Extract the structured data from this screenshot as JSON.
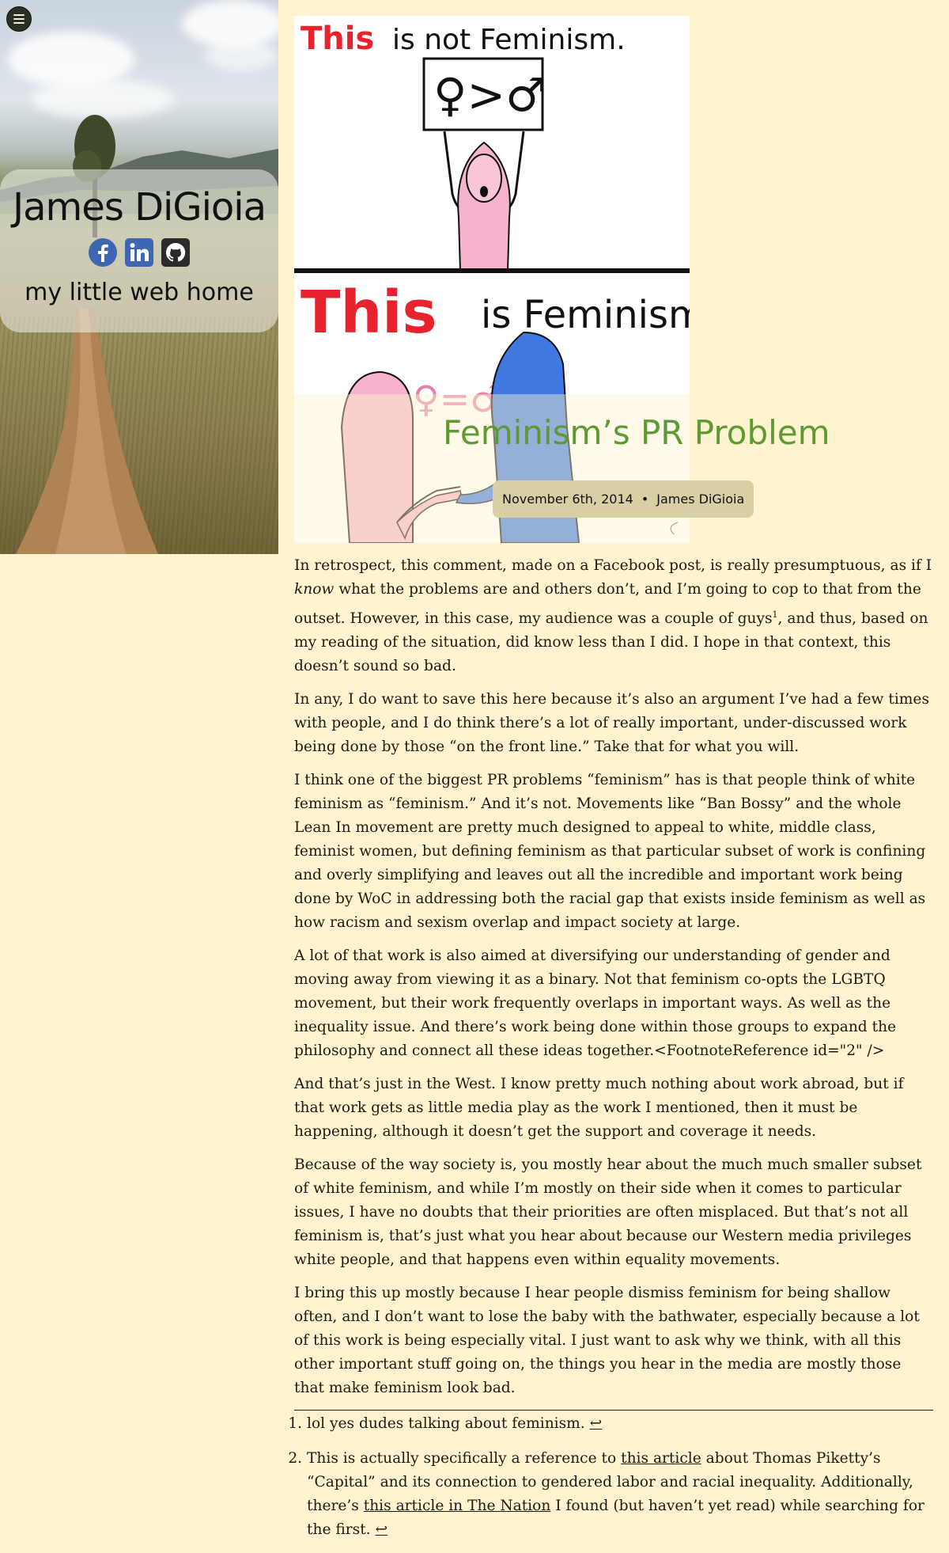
{
  "sidebar": {
    "menu_icon": "hamburger-menu-icon",
    "title": "James DiGioia",
    "tagline": "my little web home",
    "socials": [
      {
        "name": "facebook",
        "icon": "facebook-icon",
        "color": "#3b5998"
      },
      {
        "name": "linkedin",
        "icon": "linkedin-icon",
        "color": "#0e76a8"
      },
      {
        "name": "github",
        "icon": "github-icon",
        "color": "#24292e"
      }
    ]
  },
  "hero": {
    "line1_red": "This",
    "line1_rest": "is not Feminism.",
    "sign_text": "♀>♂",
    "line2_red": "This",
    "line2_rest": "is Feminism.",
    "equation": "♀=♂"
  },
  "post": {
    "title": "Feminism’s PR Problem",
    "date": "November 6th, 2014",
    "separator": "•",
    "author": "James DiGioia",
    "title_color": "#5e9a33"
  },
  "paragraphs": {
    "p1_a": "In retrospect, this comment, made on a Facebook post, is really presumptuous, as if I ",
    "p1_em": "know",
    "p1_b": " what the problems are and others don’t, and I’m going to cop to that from the outset. However, in this case, my audience was a couple of guys",
    "p1_fn": "1",
    "p1_c": ", and thus, based on my reading of the situation, did know less than I did. I hope in that context, this doesn’t sound so bad.",
    "p2": "In any, I do want to save this here because it’s also an argument I’ve had a few times with people, and I do think there’s a lot of really important, under-discussed work being done by those “on the front line.” Take that for what you will.",
    "p3": "I think one of the biggest PR problems “feminism” has is that people think of white feminism as “feminism.” And it’s not. Movements like “Ban Bossy” and the whole Lean In movement are pretty much designed to appeal to white, middle class, feminist women, but defining feminism as that particular subset of work is confining and overly simplifying and leaves out all the incredible and important work being done by WoC in addressing both the racial gap that exists inside feminism as well as how racism and sexism overlap and impact society at large.",
    "p4": "A lot of that work is also aimed at diversifying our understanding of gender and moving away from viewing it as a binary. Not that feminism co-opts the LGBTQ movement, but their work frequently overlaps in important ways. As well as the inequality issue. And there’s work being done within those groups to expand the philosophy and connect all these ideas together.<FootnoteReference id=\"2\" />",
    "p5": "And that’s just in the West. I know pretty much nothing about work abroad, but if that work gets as little media play as the work I mentioned, then it must be happening, although it doesn’t get the support and coverage it needs.",
    "p6": "Because of the way society is, you mostly hear about the much much smaller subset of white feminism, and while I’m mostly on their side when it comes to particular issues, I have no doubts that their priorities are often misplaced. But that’s not all feminism is, that’s just what you hear about because our Western media privileges white people, and that happens even within equality movements.",
    "p7": "I bring this up mostly because I hear people dismiss feminism for being shallow often, and I don’t want to lose the baby with the bathwater, especially because a lot of this work is being especially vital. I just want to ask why we think, with all this other important stuff going on, the things you hear in the media are mostly those that make feminism look bad."
  },
  "footnotes": {
    "fn1_text": "lol yes dudes talking about feminism. ",
    "backref": "↩",
    "fn2_a": "This is actually specifically a reference to ",
    "fn2_link1": "this article",
    "fn2_b": " about Thomas Piketty’s “Capital” and its connection to gendered labor and racial inequality. Additionally, there’s ",
    "fn2_link2": "this article in The Nation",
    "fn2_c": " I found (but haven’t yet read) while searching for the first. "
  }
}
